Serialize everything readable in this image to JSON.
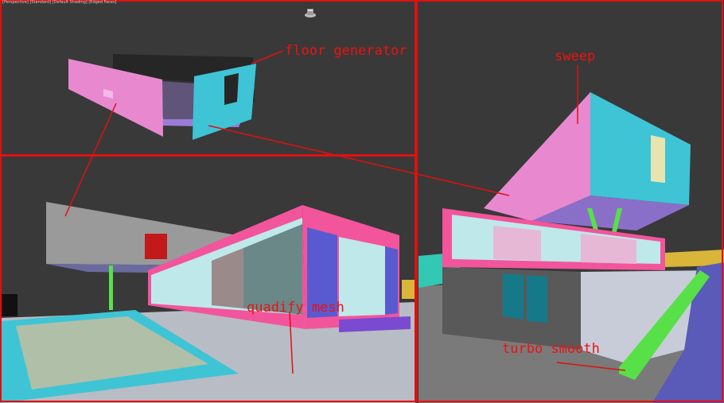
{
  "viewports": {
    "top_left": {
      "label": "[Perspective] [Standard] [Default Shading] [Edged Faces]"
    }
  },
  "annotations": {
    "floor_generator": "floor generator",
    "sweep": "sweep",
    "quadify_mesh": "quadify mesh",
    "turbo_smooth": "turbo smooth"
  },
  "colors": {
    "viewport_bg": "#393939",
    "active_border": "#e01010",
    "annotation": "#ee1111",
    "pink": "#e889d0",
    "cyan": "#3fc4d6",
    "hot_pink": "#f2559b",
    "green": "#58e048",
    "purple": "#5a3fb0",
    "gray_wall": "#9a9a9a"
  },
  "icons": {
    "viewcube": "viewcube-home-icon"
  }
}
